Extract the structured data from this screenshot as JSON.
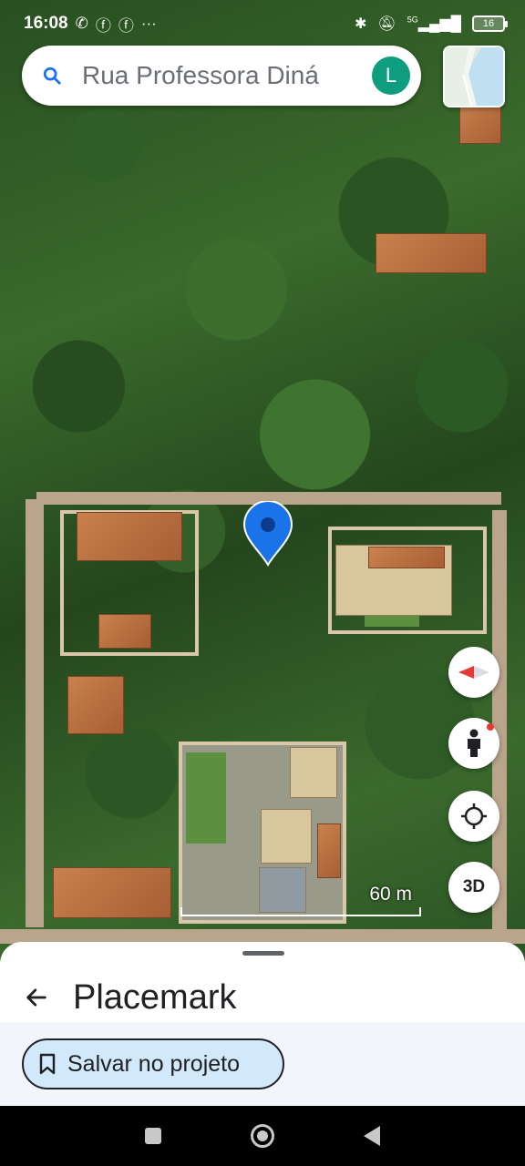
{
  "status_bar": {
    "time": "16:08",
    "notification_icons": [
      "whatsapp-icon",
      "facebook-icon",
      "facebook-icon",
      "more-dots-icon"
    ],
    "system_icons": [
      "bluetooth-icon",
      "mute-icon",
      "signal-5g-icon"
    ],
    "network_label": "5G",
    "battery_level": "16"
  },
  "search": {
    "query": "Rua Professora Diná",
    "account_initial": "L"
  },
  "map": {
    "scale_label": "60 m",
    "three_d_label": "3D"
  },
  "sheet": {
    "title": "Placemark",
    "save_label": "Salvar no projeto"
  },
  "colors": {
    "accent_blue": "#1a73e8",
    "avatar_green": "#0f9d7f",
    "save_button_bg": "#d2e9fb"
  }
}
